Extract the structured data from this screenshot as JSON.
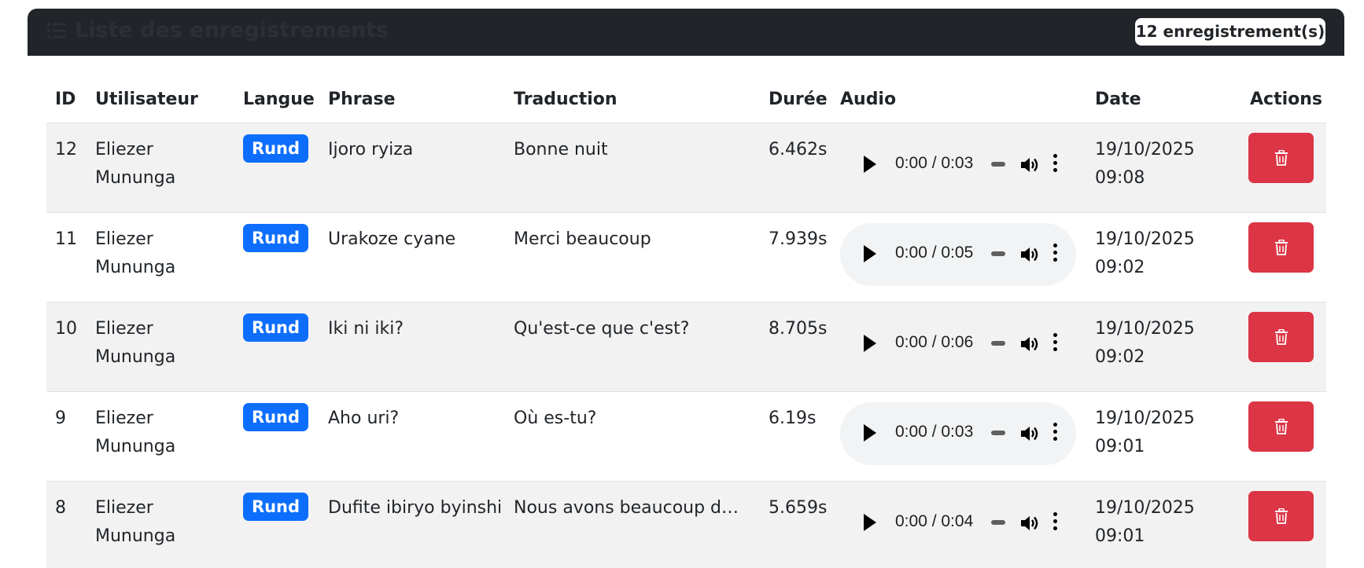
{
  "header": {
    "title": "Liste des enregistrements",
    "count_badge": "12 enregistrement(s)"
  },
  "table": {
    "columns": [
      "ID",
      "Utilisateur",
      "Langue",
      "Phrase",
      "Traduction",
      "Durée",
      "Audio",
      "Date",
      "Actions"
    ],
    "rows": [
      {
        "id": "12",
        "user_first": "Eliezer",
        "user_last": "Mununga",
        "lang": "Rund",
        "phrase": "Ijoro ryiza",
        "translation": "Bonne nuit",
        "duration": "6.462s",
        "audio_time": "0:00 / 0:03",
        "date": "19/10/2025",
        "time": "09:08"
      },
      {
        "id": "11",
        "user_first": "Eliezer",
        "user_last": "Mununga",
        "lang": "Rund",
        "phrase": "Urakoze cyane",
        "translation": "Merci beaucoup",
        "duration": "7.939s",
        "audio_time": "0:00 / 0:05",
        "date": "19/10/2025",
        "time": "09:02"
      },
      {
        "id": "10",
        "user_first": "Eliezer",
        "user_last": "Mununga",
        "lang": "Rund",
        "phrase": "Iki ni iki?",
        "translation": "Qu'est-ce que c'est?",
        "duration": "8.705s",
        "audio_time": "0:00 / 0:06",
        "date": "19/10/2025",
        "time": "09:02"
      },
      {
        "id": "9",
        "user_first": "Eliezer",
        "user_last": "Mununga",
        "lang": "Rund",
        "phrase": "Aho uri?",
        "translation": "Où es-tu?",
        "duration": "6.19s",
        "audio_time": "0:00 / 0:03",
        "date": "19/10/2025",
        "time": "09:01"
      },
      {
        "id": "8",
        "user_first": "Eliezer",
        "user_last": "Mununga",
        "lang": "Rund",
        "phrase": "Dufite ibiryo byinshi",
        "translation": "Nous avons beaucoup de nourriture",
        "duration": "5.659s",
        "audio_time": "0:00 / 0:04",
        "date": "19/10/2025",
        "time": "09:01"
      }
    ]
  },
  "icons": {
    "header": "list-icon",
    "play": "play-icon",
    "volume": "volume-icon",
    "menu": "more-vertical-icon",
    "delete": "trash-icon"
  },
  "colors": {
    "header_bg": "#212529",
    "badge_primary": "#0d6efd",
    "danger": "#dc3545",
    "row_stripe": "#f2f2f2"
  }
}
